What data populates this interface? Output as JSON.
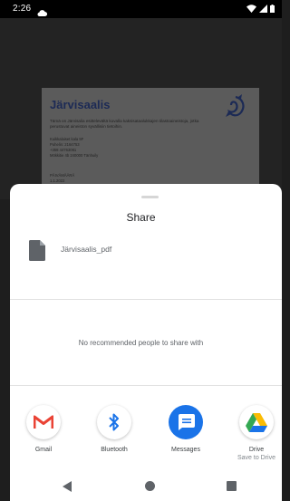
{
  "status_bar": {
    "time": "2:26"
  },
  "document": {
    "title": "Järvisaalis",
    "intro": "Tämä on Järvisalia esittelevältä kuvalla kaksisataalukkajen tilastoaineistoja, jotka perustuvat aineiston syvällisiin tietoihin.",
    "address_lines": [
      "Kuikkalaiset kala 5F",
      "Puhelin: 2164753",
      "+358 44763081",
      "Mökkitie 4b 240000 Tänhuily"
    ],
    "sign_lines": [
      "PÄIVÄMÄÄRÄ",
      "1.1.2022"
    ]
  },
  "share_sheet": {
    "title": "Share",
    "file_name": "Järvisaalis_pdf",
    "no_people_text": "No recommended people to share with",
    "apps": [
      {
        "label": "Gmail",
        "subtitle": "",
        "icon": "gmail-icon"
      },
      {
        "label": "Bluetooth",
        "subtitle": "",
        "icon": "bluetooth-icon"
      },
      {
        "label": "Messages",
        "subtitle": "",
        "icon": "messages-icon"
      },
      {
        "label": "Drive",
        "subtitle": "Save to Drive",
        "icon": "drive-icon"
      }
    ]
  },
  "colors": {
    "accent": "#1a73e8",
    "gmail_red": "#ea4335",
    "drive_green": "#34a853",
    "drive_yellow": "#fbbc04"
  }
}
